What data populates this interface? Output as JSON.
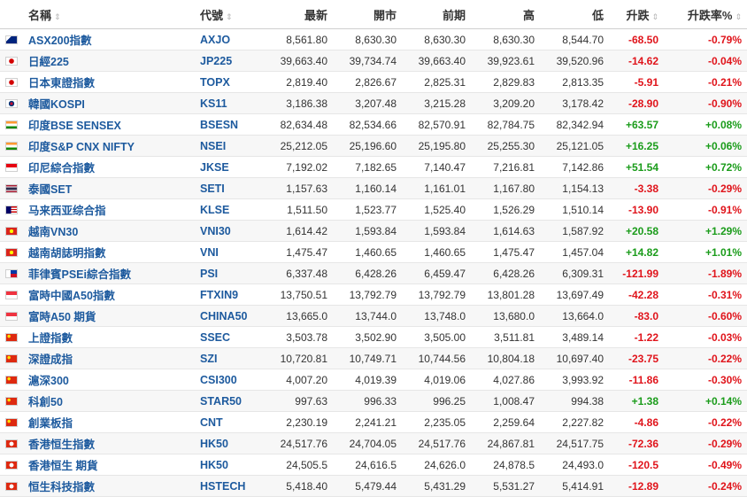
{
  "headers": {
    "name": "名稱",
    "symbol": "代號",
    "last": "最新",
    "open": "開市",
    "prev": "前期",
    "high": "高",
    "low": "低",
    "change": "升跌",
    "change_pct": "升跌率%",
    "sort_glyph": "⇕"
  },
  "colors": {
    "up": "#1b9c1b",
    "down": "#e0141b",
    "link": "#1d5a9e"
  },
  "rows": [
    {
      "flag": "au",
      "name": "ASX200指數",
      "symbol": "AXJO",
      "last": "8,561.80",
      "open": "8,630.30",
      "prev": "8,630.30",
      "high": "8,630.30",
      "low": "8,544.70",
      "change": "-68.50",
      "pct": "-0.79%"
    },
    {
      "flag": "jp",
      "name": "日經225",
      "symbol": "JP225",
      "last": "39,663.40",
      "open": "39,734.74",
      "prev": "39,663.40",
      "high": "39,923.61",
      "low": "39,520.96",
      "change": "-14.62",
      "pct": "-0.04%"
    },
    {
      "flag": "jp",
      "name": "日本東證指數",
      "symbol": "TOPX",
      "last": "2,819.40",
      "open": "2,826.67",
      "prev": "2,825.31",
      "high": "2,829.83",
      "low": "2,813.35",
      "change": "-5.91",
      "pct": "-0.21%"
    },
    {
      "flag": "kr",
      "name": "韓國KOSPI",
      "symbol": "KS11",
      "last": "3,186.38",
      "open": "3,207.48",
      "prev": "3,215.28",
      "high": "3,209.20",
      "low": "3,178.42",
      "change": "-28.90",
      "pct": "-0.90%"
    },
    {
      "flag": "in",
      "name": "印度BSE SENSEX",
      "symbol": "BSESN",
      "last": "82,634.48",
      "open": "82,534.66",
      "prev": "82,570.91",
      "high": "82,784.75",
      "low": "82,342.94",
      "change": "+63.57",
      "pct": "+0.08%"
    },
    {
      "flag": "in",
      "name": "印度S&P CNX NIFTY",
      "symbol": "NSEI",
      "last": "25,212.05",
      "open": "25,196.60",
      "prev": "25,195.80",
      "high": "25,255.30",
      "low": "25,121.05",
      "change": "+16.25",
      "pct": "+0.06%"
    },
    {
      "flag": "id",
      "name": "印尼綜合指數",
      "symbol": "JKSE",
      "last": "7,192.02",
      "open": "7,182.65",
      "prev": "7,140.47",
      "high": "7,216.81",
      "low": "7,142.86",
      "change": "+51.54",
      "pct": "+0.72%"
    },
    {
      "flag": "th",
      "name": "泰國SET",
      "symbol": "SETI",
      "last": "1,157.63",
      "open": "1,160.14",
      "prev": "1,161.01",
      "high": "1,167.80",
      "low": "1,154.13",
      "change": "-3.38",
      "pct": "-0.29%"
    },
    {
      "flag": "my",
      "name": "马来西亚综合指",
      "symbol": "KLSE",
      "last": "1,511.50",
      "open": "1,523.77",
      "prev": "1,525.40",
      "high": "1,526.29",
      "low": "1,510.14",
      "change": "-13.90",
      "pct": "-0.91%"
    },
    {
      "flag": "vn",
      "name": "越南VN30",
      "symbol": "VNI30",
      "last": "1,614.42",
      "open": "1,593.84",
      "prev": "1,593.84",
      "high": "1,614.63",
      "low": "1,587.92",
      "change": "+20.58",
      "pct": "+1.29%"
    },
    {
      "flag": "vn",
      "name": "越南胡誌明指數",
      "symbol": "VNI",
      "last": "1,475.47",
      "open": "1,460.65",
      "prev": "1,460.65",
      "high": "1,475.47",
      "low": "1,457.04",
      "change": "+14.82",
      "pct": "+1.01%"
    },
    {
      "flag": "ph",
      "name": "菲律賓PSEi綜合指數",
      "symbol": "PSI",
      "last": "6,337.48",
      "open": "6,428.26",
      "prev": "6,459.47",
      "high": "6,428.26",
      "low": "6,309.31",
      "change": "-121.99",
      "pct": "-1.89%"
    },
    {
      "flag": "sg",
      "name": "富時中國A50指數",
      "symbol": "FTXIN9",
      "last": "13,750.51",
      "open": "13,792.79",
      "prev": "13,792.79",
      "high": "13,801.28",
      "low": "13,697.49",
      "change": "-42.28",
      "pct": "-0.31%"
    },
    {
      "flag": "sg",
      "name": "富時A50 期貨",
      "symbol": "CHINA50",
      "last": "13,665.0",
      "open": "13,744.0",
      "prev": "13,748.0",
      "high": "13,680.0",
      "low": "13,664.0",
      "change": "-83.0",
      "pct": "-0.60%"
    },
    {
      "flag": "cn",
      "name": "上證指數",
      "symbol": "SSEC",
      "last": "3,503.78",
      "open": "3,502.90",
      "prev": "3,505.00",
      "high": "3,511.81",
      "low": "3,489.14",
      "change": "-1.22",
      "pct": "-0.03%"
    },
    {
      "flag": "cn",
      "name": "深證成指",
      "symbol": "SZI",
      "last": "10,720.81",
      "open": "10,749.71",
      "prev": "10,744.56",
      "high": "10,804.18",
      "low": "10,697.40",
      "change": "-23.75",
      "pct": "-0.22%"
    },
    {
      "flag": "cn",
      "name": "滬深300",
      "symbol": "CSI300",
      "last": "4,007.20",
      "open": "4,019.39",
      "prev": "4,019.06",
      "high": "4,027.86",
      "low": "3,993.92",
      "change": "-11.86",
      "pct": "-0.30%"
    },
    {
      "flag": "cn",
      "name": "科創50",
      "symbol": "STAR50",
      "last": "997.63",
      "open": "996.33",
      "prev": "996.25",
      "high": "1,008.47",
      "low": "994.38",
      "change": "+1.38",
      "pct": "+0.14%"
    },
    {
      "flag": "cn",
      "name": "創業板指",
      "symbol": "CNT",
      "last": "2,230.19",
      "open": "2,241.21",
      "prev": "2,235.05",
      "high": "2,259.64",
      "low": "2,227.82",
      "change": "-4.86",
      "pct": "-0.22%"
    },
    {
      "flag": "hk",
      "name": "香港恒生指數",
      "symbol": "HK50",
      "last": "24,517.76",
      "open": "24,704.05",
      "prev": "24,517.76",
      "high": "24,867.81",
      "low": "24,517.75",
      "change": "-72.36",
      "pct": "-0.29%"
    },
    {
      "flag": "hk",
      "name": "香港恒生 期貨",
      "symbol": "HK50",
      "last": "24,505.5",
      "open": "24,616.5",
      "prev": "24,626.0",
      "high": "24,878.5",
      "low": "24,493.0",
      "change": "-120.5",
      "pct": "-0.49%"
    },
    {
      "flag": "hk",
      "name": "恒生科技指數",
      "symbol": "HSTECH",
      "last": "5,418.40",
      "open": "5,479.44",
      "prev": "5,431.29",
      "high": "5,531.27",
      "low": "5,414.91",
      "change": "-12.89",
      "pct": "-0.24%"
    }
  ]
}
